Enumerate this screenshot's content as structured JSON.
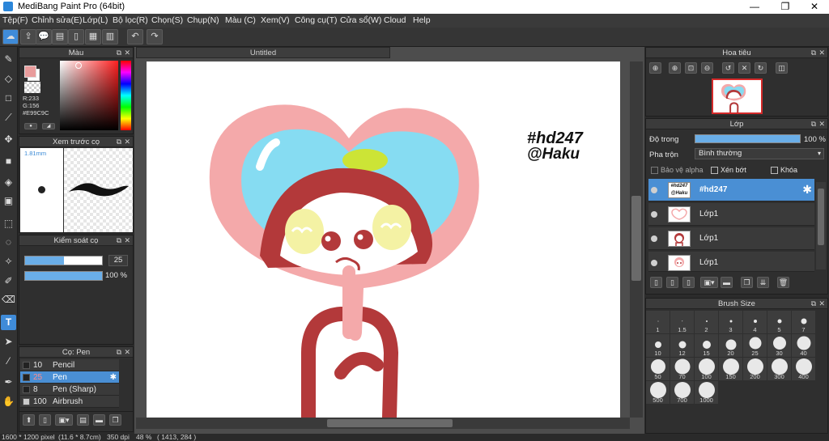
{
  "window": {
    "title": "MediBang Paint Pro (64bit)",
    "minimize": "—",
    "maximize": "❐",
    "close": "✕"
  },
  "menu": [
    "Tệp(F)",
    "Chỉnh sửa(E)",
    "Lớp(L)",
    "Bộ lọc(R)",
    "Chọn(S)",
    "Chụp(N)",
    "Màu (C)",
    "Xem(V)",
    "Công cụ(T)",
    "Cửa sổ(W)",
    "Cloud",
    "Help"
  ],
  "document": {
    "tab_title": "Untitled",
    "canvas_text_line1": "#hd247",
    "canvas_text_line2": "@Haku"
  },
  "color_panel": {
    "title": "Màu",
    "r_label": "R:233",
    "g_label": "G:156",
    "hex": "#E99C9C",
    "primary_color": "#E99C9C",
    "secondary_color": "#FFFFFF"
  },
  "preview_panel": {
    "title": "Xem trước cọ",
    "size_label": "1.81mm"
  },
  "brush_control": {
    "title": "Kiểm soát cọ",
    "size_value": "25",
    "opacity_value": "100 %"
  },
  "brush_panel": {
    "title": "Cọ: Pen",
    "items": [
      {
        "size": "10",
        "name": "Pencil",
        "selected": false
      },
      {
        "size": "25",
        "name": "Pen",
        "selected": true
      },
      {
        "size": "8",
        "name": "Pen (Sharp)",
        "selected": false
      },
      {
        "size": "100",
        "name": "Airbrush",
        "selected": false
      }
    ]
  },
  "navigator": {
    "title": "Hoa tiêu"
  },
  "layer_panel": {
    "title": "Lớp",
    "opacity_label": "Độ trong",
    "opacity_value": "100 %",
    "blend_label": "Pha trộn",
    "blend_value": "Bình thường",
    "protect_alpha": "Bảo vệ alpha",
    "clipping": "Xén bớt",
    "lock": "Khóa",
    "layers": [
      {
        "name": "#hd247",
        "selected": true
      },
      {
        "name": "Lớp1",
        "selected": false
      },
      {
        "name": "Lớp1",
        "selected": false
      },
      {
        "name": "Lớp1",
        "selected": false
      }
    ]
  },
  "brush_size_panel": {
    "title": "Brush Size",
    "sizes": [
      "1",
      "1.5",
      "2",
      "3",
      "4",
      "5",
      "7",
      "10",
      "12",
      "15",
      "20",
      "25",
      "30",
      "40",
      "50",
      "70",
      "100",
      "150",
      "200",
      "300",
      "400",
      "500",
      "700",
      "1000"
    ]
  },
  "status": {
    "dimensions": "1600 * 1200 pixel",
    "physical": "(11.6 * 8.7cm)",
    "dpi": "350 dpi",
    "zoom": "48 %",
    "coords": "( 1413, 284 )"
  },
  "colors": {
    "accent": "#4a8fd4",
    "heart_pink": "#f4a9aa",
    "hood_red": "#b3393a",
    "sky_blue": "#86dcf2",
    "cheek_yellow": "#f4f2a4",
    "leaf_green": "#cce436"
  }
}
